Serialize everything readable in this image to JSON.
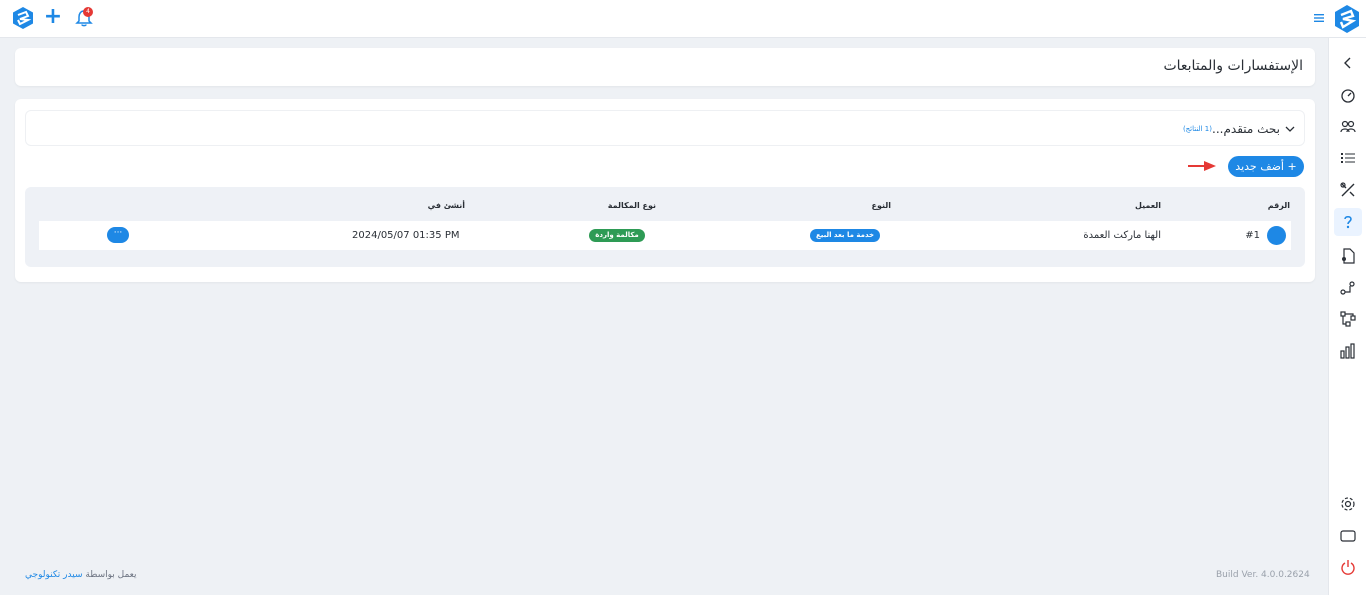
{
  "topbar": {
    "notification_count": "4",
    "icons": [
      "app-logo-icon",
      "plus-icon",
      "bell-icon",
      "hamburger-menu-icon",
      "brand-logo-icon"
    ]
  },
  "sidebar": {
    "icons": [
      "chevron-left-icon",
      "dashboard-gauge-icon",
      "users-icon",
      "list-icon",
      "tools-icon",
      "inquiries-icon",
      "document-user-icon",
      "route-icon",
      "hierarchy-icon",
      "bar-chart-icon",
      "settings-gear-icon",
      "screen-icon",
      "power-icon"
    ],
    "active": "inquiries-icon"
  },
  "page": {
    "title": "الإستفسارات والمتابعات"
  },
  "search": {
    "label": "بحث متقدم...",
    "results": "(1 النتائج)"
  },
  "actions": {
    "add_new": "+ أضف جديد"
  },
  "table": {
    "headers": {
      "number": "الرقم",
      "client": "العميل",
      "type": "النوع",
      "call_type": "نوع المكالمة",
      "created_at": "أنشئ في"
    },
    "rows": [
      {
        "number": "#1",
        "client": "الهنا ماركت العمدة",
        "type": "خدمة ما بعد البيع",
        "call_type": "مكالمة واردة",
        "created_at": "2024/05/07 01:35 PM",
        "menu": "···"
      }
    ]
  },
  "footer": {
    "powered_prefix": "يعمل بواسطة",
    "powered_brand": "سيدر تكنولوجي",
    "build": "Build Ver. 4.0.0.2624"
  },
  "colors": {
    "accent": "#1e88e5",
    "success": "#2e9b55",
    "danger": "#e53935",
    "background": "#eef1f5"
  }
}
